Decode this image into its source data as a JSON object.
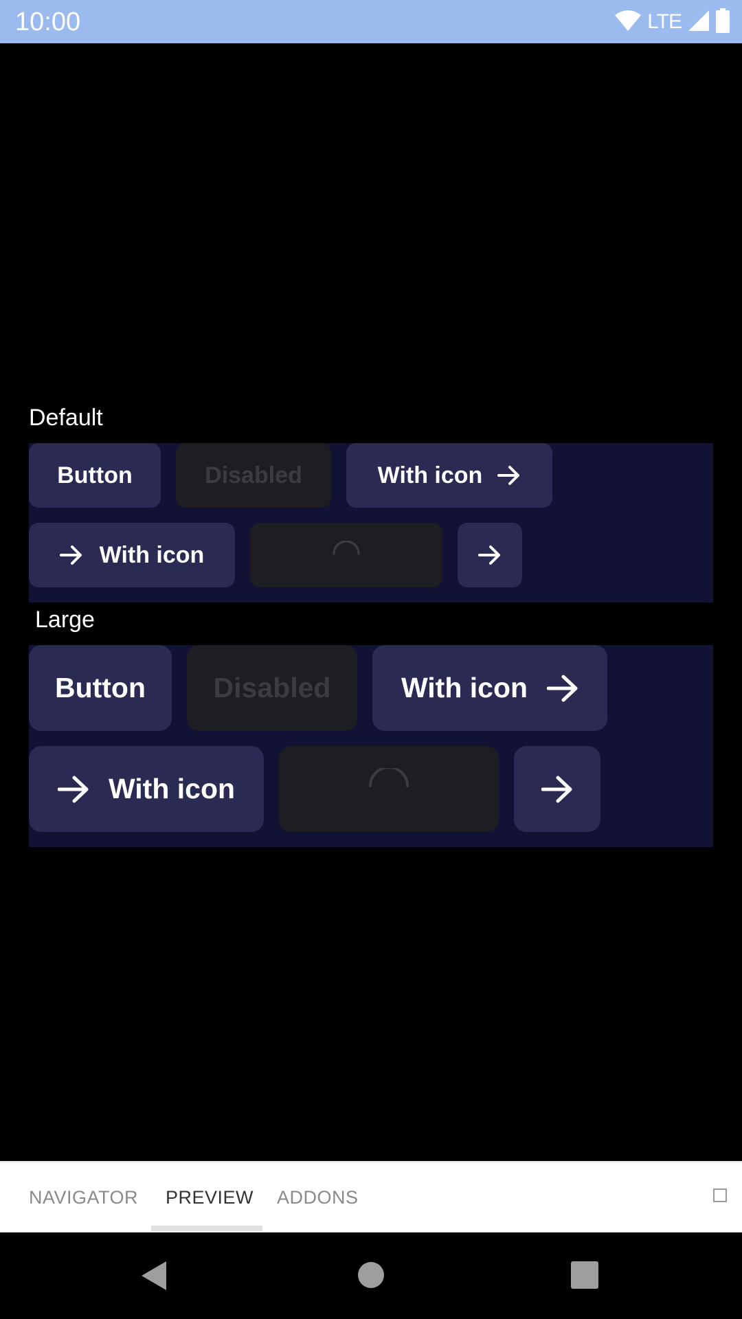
{
  "status_bar": {
    "time": "10:00",
    "network": "LTE"
  },
  "sections": {
    "default": {
      "title": "Default",
      "row1": {
        "button": "Button",
        "disabled": "Disabled",
        "with_icon": "With icon"
      },
      "row2": {
        "with_icon_leading": "With icon"
      }
    },
    "large": {
      "title": "Large",
      "row1": {
        "button": "Button",
        "disabled": "Disabled",
        "with_icon": "With icon"
      },
      "row2": {
        "with_icon_leading": "With icon"
      }
    }
  },
  "tabs": [
    {
      "label": "NAVIGATOR",
      "active": false
    },
    {
      "label": "PREVIEW",
      "active": true
    },
    {
      "label": "ADDONS",
      "active": false
    }
  ],
  "colors": {
    "status_bar": "#9bbbef",
    "panel_bg": "#121235",
    "button_bg": "#2a2a52",
    "disabled_bg": "#1e1e22",
    "disabled_text": "#3b3b40"
  },
  "icons": {
    "arrow": "arrow-right-icon",
    "spinner": "loading-spinner-icon",
    "wifi": "wifi-icon",
    "signal": "signal-icon",
    "battery": "battery-icon"
  }
}
